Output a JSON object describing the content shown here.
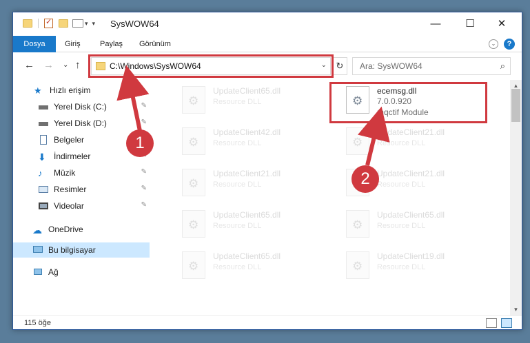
{
  "window": {
    "title": "SysWOW64"
  },
  "ribbon": {
    "tabs": [
      "Dosya",
      "Giriş",
      "Paylaş",
      "Görünüm"
    ]
  },
  "controls": {
    "minimize": "—",
    "maximize": "☐",
    "close": "✕"
  },
  "address": {
    "path": "C:\\Windows\\SysWOW64"
  },
  "search": {
    "placeholder": "Ara: SysWOW64"
  },
  "sidebar": {
    "quick_access": "Hızlı erişim",
    "items": [
      "Yerel Disk (C:)",
      "Yerel Disk (D:)",
      "Belgeler",
      "İndirmeler",
      "Müzik",
      "Resimler",
      "Videolar"
    ],
    "onedrive": "OneDrive",
    "this_pc": "Bu bilgisayar",
    "network": "Ağ"
  },
  "files": {
    "left": [
      {
        "name": "UpdateClient65.dll",
        "type": "Resource DLL"
      },
      {
        "name": "UpdateClient42.dll",
        "type": "Resource DLL"
      },
      {
        "name": "UpdateClient21.dll",
        "type": "Resource DLL"
      },
      {
        "name": "UpdateClient65.dll",
        "type": "Resource DLL"
      },
      {
        "name": "UpdateClient65.dll",
        "type": "Resource DLL"
      }
    ],
    "highlighted": {
      "name": "ecemsg.dll",
      "version": "7.0.0.920",
      "type": "mqctif Module"
    },
    "right": [
      {
        "name": "UpdateClient21.dll",
        "type": "Resource DLL"
      },
      {
        "name": "UpdateClient21.dll",
        "type": "Resource DLL"
      },
      {
        "name": "UpdateClient65.dll",
        "type": "Resource DLL"
      },
      {
        "name": "UpdateClient19.dll",
        "type": "Resource DLL"
      }
    ]
  },
  "status": {
    "count": "115 öğe"
  },
  "annotations": {
    "step1": "1",
    "step2": "2"
  },
  "colors": {
    "accent": "#1979ca",
    "annotation": "#d0393f",
    "selected": "#cce8ff"
  }
}
